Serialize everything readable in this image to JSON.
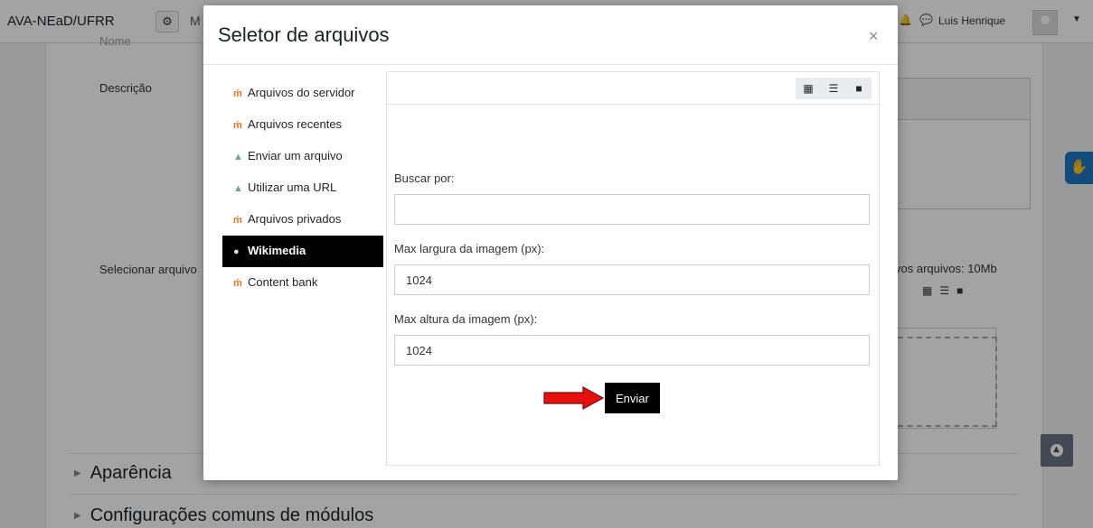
{
  "topbar": {
    "brand": "AVA-NEaD/UFRR",
    "menu_partial": "M",
    "user_name": "Luis Henrique"
  },
  "background": {
    "field_name_partial": "Nome",
    "label_description": "Descrição",
    "label_select_files": "Selecionar arquivo",
    "max_files_text": "vos arquivos: 10Mb",
    "section_appearance": "Aparência",
    "section_common_modules": "Configurações comuns de módulos"
  },
  "modal": {
    "title": "Seletor de arquivos",
    "close_symbol": "×",
    "repositories": [
      {
        "label": "Arquivos do servidor",
        "icon": "moodle-icon",
        "active": false
      },
      {
        "label": "Arquivos recentes",
        "icon": "moodle-icon",
        "active": false
      },
      {
        "label": "Enviar um arquivo",
        "icon": "upload-icon",
        "active": false
      },
      {
        "label": "Utilizar uma URL",
        "icon": "url-icon",
        "active": false
      },
      {
        "label": "Arquivos privados",
        "icon": "moodle-icon",
        "active": false
      },
      {
        "label": "Wikimedia",
        "icon": "wikimedia-icon",
        "active": true
      },
      {
        "label": "Content bank",
        "icon": "moodle-icon",
        "active": false
      }
    ],
    "form": {
      "search_label": "Buscar por:",
      "search_value": "",
      "max_width_label": "Max largura da imagem (px):",
      "max_width_value": "1024",
      "max_height_label": "Max altura da imagem (px):",
      "max_height_value": "1024",
      "submit_label": "Enviar"
    },
    "view_icons": [
      "grid-icon",
      "list-icon",
      "folder-icon"
    ]
  },
  "colors": {
    "active_repo_bg": "#000000",
    "arrow_red": "#e8100d",
    "accessibility_blue": "#1c77c3"
  }
}
